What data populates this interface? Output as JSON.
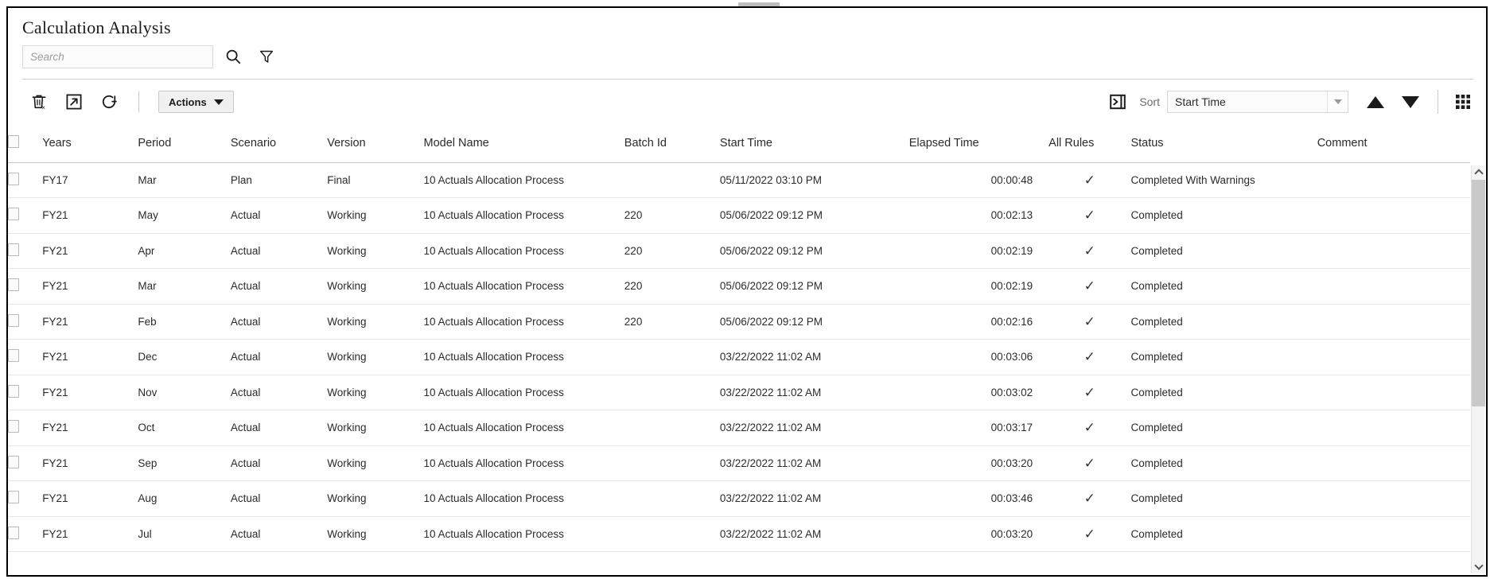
{
  "window": {
    "title": "Calculation Analysis",
    "drag_handle": "drag-handle"
  },
  "search": {
    "placeholder": "Search",
    "value": "",
    "search_icon": "search-icon",
    "filter_icon": "filter-icon"
  },
  "toolbar": {
    "delete_icon": "delete-icon",
    "export_icon": "export-icon",
    "refresh_icon": "refresh-icon",
    "actions_label": "Actions",
    "panel_icon": "show-panel-icon",
    "sort_label": "Sort",
    "sort_value": "Start Time",
    "sort_asc_icon": "sort-ascending-icon",
    "sort_desc_icon": "sort-descending-icon",
    "grid_icon": "grid-view-icon"
  },
  "table": {
    "columns": [
      "Years",
      "Period",
      "Scenario",
      "Version",
      "Model Name",
      "Batch Id",
      "Start Time",
      "Elapsed Time",
      "All Rules",
      "Status",
      "Comment"
    ],
    "rows": [
      {
        "years": "FY17",
        "period": "Mar",
        "scenario": "Plan",
        "version": "Final",
        "model": "10 Actuals Allocation Process",
        "batch": "",
        "start": "05/11/2022 03:10 PM",
        "elapsed": "00:00:48",
        "all_rules": "✓",
        "status": "Completed With Warnings",
        "comment": ""
      },
      {
        "years": "FY21",
        "period": "May",
        "scenario": "Actual",
        "version": "Working",
        "model": "10 Actuals Allocation Process",
        "batch": "220",
        "start": "05/06/2022 09:12 PM",
        "elapsed": "00:02:13",
        "all_rules": "✓",
        "status": "Completed",
        "comment": ""
      },
      {
        "years": "FY21",
        "period": "Apr",
        "scenario": "Actual",
        "version": "Working",
        "model": "10 Actuals Allocation Process",
        "batch": "220",
        "start": "05/06/2022 09:12 PM",
        "elapsed": "00:02:19",
        "all_rules": "✓",
        "status": "Completed",
        "comment": ""
      },
      {
        "years": "FY21",
        "period": "Mar",
        "scenario": "Actual",
        "version": "Working",
        "model": "10 Actuals Allocation Process",
        "batch": "220",
        "start": "05/06/2022 09:12 PM",
        "elapsed": "00:02:19",
        "all_rules": "✓",
        "status": "Completed",
        "comment": ""
      },
      {
        "years": "FY21",
        "period": "Feb",
        "scenario": "Actual",
        "version": "Working",
        "model": "10 Actuals Allocation Process",
        "batch": "220",
        "start": "05/06/2022 09:12 PM",
        "elapsed": "00:02:16",
        "all_rules": "✓",
        "status": "Completed",
        "comment": ""
      },
      {
        "years": "FY21",
        "period": "Dec",
        "scenario": "Actual",
        "version": "Working",
        "model": "10 Actuals Allocation Process",
        "batch": "",
        "start": "03/22/2022 11:02 AM",
        "elapsed": "00:03:06",
        "all_rules": "✓",
        "status": "Completed",
        "comment": ""
      },
      {
        "years": "FY21",
        "period": "Nov",
        "scenario": "Actual",
        "version": "Working",
        "model": "10 Actuals Allocation Process",
        "batch": "",
        "start": "03/22/2022 11:02 AM",
        "elapsed": "00:03:02",
        "all_rules": "✓",
        "status": "Completed",
        "comment": ""
      },
      {
        "years": "FY21",
        "period": "Oct",
        "scenario": "Actual",
        "version": "Working",
        "model": "10 Actuals Allocation Process",
        "batch": "",
        "start": "03/22/2022 11:02 AM",
        "elapsed": "00:03:17",
        "all_rules": "✓",
        "status": "Completed",
        "comment": ""
      },
      {
        "years": "FY21",
        "period": "Sep",
        "scenario": "Actual",
        "version": "Working",
        "model": "10 Actuals Allocation Process",
        "batch": "",
        "start": "03/22/2022 11:02 AM",
        "elapsed": "00:03:20",
        "all_rules": "✓",
        "status": "Completed",
        "comment": ""
      },
      {
        "years": "FY21",
        "period": "Aug",
        "scenario": "Actual",
        "version": "Working",
        "model": "10 Actuals Allocation Process",
        "batch": "",
        "start": "03/22/2022 11:02 AM",
        "elapsed": "00:03:46",
        "all_rules": "✓",
        "status": "Completed",
        "comment": ""
      },
      {
        "years": "FY21",
        "period": "Jul",
        "scenario": "Actual",
        "version": "Working",
        "model": "10 Actuals Allocation Process",
        "batch": "",
        "start": "03/22/2022 11:02 AM",
        "elapsed": "00:03:20",
        "all_rules": "✓",
        "status": "Completed",
        "comment": ""
      }
    ]
  },
  "scrollbar": {
    "up_icon": "chevron-up-icon",
    "down_icon": "chevron-down-icon"
  },
  "colors": {
    "border": "#000000",
    "row_line": "#e6e6e6",
    "header_line": "#c6c6c6",
    "text": "#2b2b2b",
    "muted": "#6b6b6b",
    "scroll_thumb": "#c9c9c9"
  }
}
